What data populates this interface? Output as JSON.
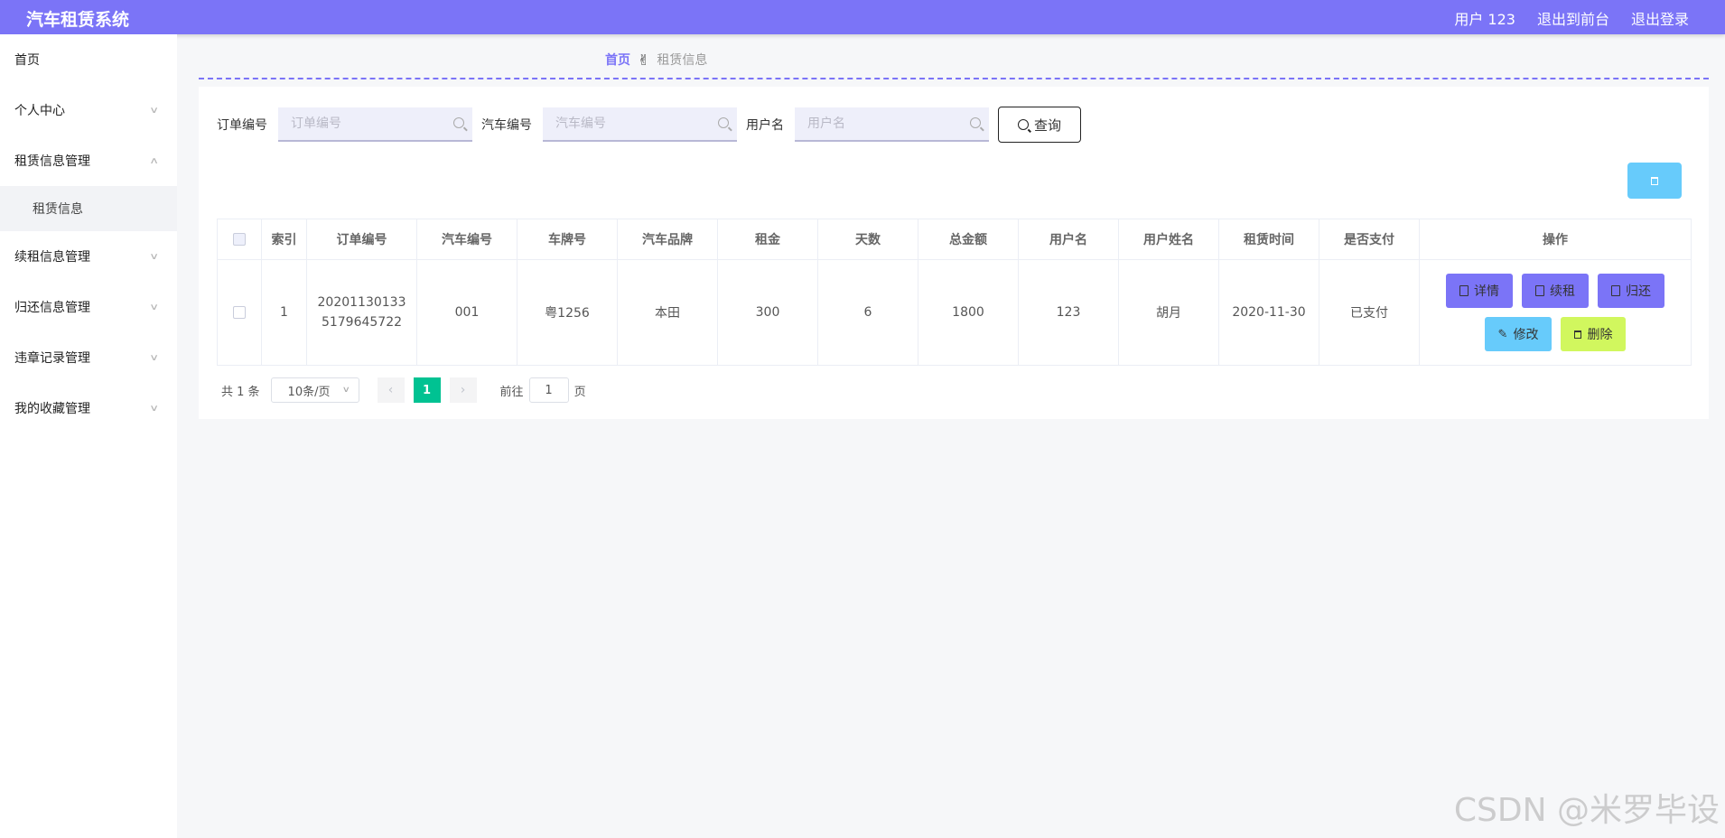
{
  "header": {
    "title": "汽车租赁系统",
    "links": [
      "用户 123",
      "退出到前台",
      "退出登录"
    ]
  },
  "sidebar": {
    "items": [
      {
        "label": "首页",
        "has_chevron": false
      },
      {
        "label": "个人中心",
        "has_chevron": true
      },
      {
        "label": "租赁信息管理",
        "has_chevron": true,
        "expanded": true
      },
      {
        "label": "租赁信息",
        "sub": true
      },
      {
        "label": "续租信息管理",
        "has_chevron": true
      },
      {
        "label": "归还信息管理",
        "has_chevron": true
      },
      {
        "label": "违章记录管理",
        "has_chevron": true
      },
      {
        "label": "我的收藏管理",
        "has_chevron": true
      }
    ]
  },
  "breadcrumb": {
    "home": "首页",
    "separator": "✌",
    "current": "租赁信息"
  },
  "search": {
    "fields": [
      {
        "label": "订单编号",
        "placeholder": "订单编号",
        "value": ""
      },
      {
        "label": "汽车编号",
        "placeholder": "汽车编号",
        "value": ""
      },
      {
        "label": "用户名",
        "placeholder": "用户名",
        "value": ""
      }
    ],
    "button_label": "查询"
  },
  "table": {
    "headers": [
      "索引",
      "订单编号",
      "汽车编号",
      "车牌号",
      "汽车品牌",
      "租金",
      "天数",
      "总金额",
      "用户名",
      "用户姓名",
      "租赁时间",
      "是否支付",
      "操作"
    ],
    "rows": [
      {
        "index": "1",
        "order_no": "202011301335179645722",
        "car_no": "001",
        "plate": "粤1256",
        "brand": "本田",
        "rent": "300",
        "days": "6",
        "total": "1800",
        "username": "123",
        "name": "胡月",
        "rent_time": "2020-11-30",
        "paid": "已支付"
      }
    ],
    "actions": {
      "detail": "详情",
      "renew": "续租",
      "return": "归还",
      "edit": "修改",
      "delete": "删除"
    }
  },
  "pager": {
    "total": "共 1 条",
    "page_size": "10条/页",
    "current_page": "1",
    "goto_prefix": "前往",
    "goto_value": "1",
    "goto_suffix": "页"
  },
  "watermark": "CSDN @米罗毕设",
  "colors": {
    "accent": "#7b74f7",
    "info": "#67cbfb",
    "lime": "#d1f75e",
    "active_page": "#00c292"
  }
}
